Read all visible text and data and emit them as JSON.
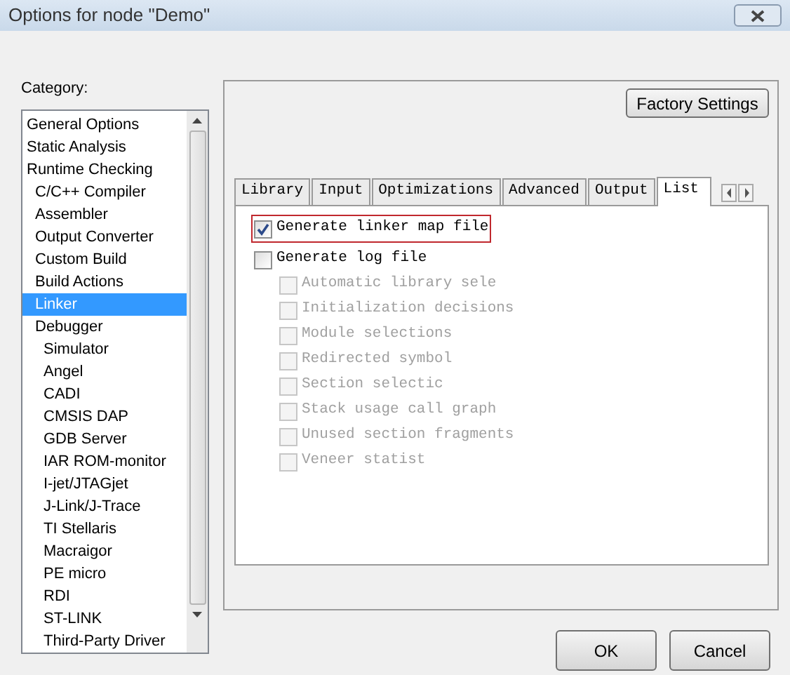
{
  "window": {
    "title": "Options for node \"Demo\""
  },
  "category": {
    "label": "Category:",
    "items": [
      {
        "label": "General Options",
        "selected": false
      },
      {
        "label": "Static Analysis",
        "selected": false
      },
      {
        "label": "Runtime Checking",
        "selected": false,
        "children": [
          {
            "label": "C/C++ Compiler",
            "selected": false
          },
          {
            "label": "Assembler",
            "selected": false
          },
          {
            "label": "Output Converter",
            "selected": false
          },
          {
            "label": "Custom Build",
            "selected": false
          },
          {
            "label": "Build Actions",
            "selected": false
          },
          {
            "label": "Linker",
            "selected": true
          },
          {
            "label": "Debugger",
            "selected": false,
            "children": [
              {
                "label": "Simulator",
                "selected": false
              },
              {
                "label": "Angel",
                "selected": false
              },
              {
                "label": "CADI",
                "selected": false
              },
              {
                "label": "CMSIS DAP",
                "selected": false
              },
              {
                "label": "GDB Server",
                "selected": false
              },
              {
                "label": "IAR ROM-monitor",
                "selected": false
              },
              {
                "label": "I-jet/JTAGjet",
                "selected": false
              },
              {
                "label": "J-Link/J-Trace",
                "selected": false
              },
              {
                "label": "TI Stellaris",
                "selected": false
              },
              {
                "label": "Macraigor",
                "selected": false
              },
              {
                "label": "PE micro",
                "selected": false
              },
              {
                "label": "RDI",
                "selected": false
              },
              {
                "label": "ST-LINK",
                "selected": false
              },
              {
                "label": "Third-Party Driver",
                "selected": false
              }
            ]
          }
        ]
      }
    ]
  },
  "factory_button": "Factory Settings",
  "tabs": [
    {
      "label": "Library",
      "selected": false
    },
    {
      "label": "Input",
      "selected": false
    },
    {
      "label": "Optimizations",
      "selected": false
    },
    {
      "label": "Advanced",
      "selected": false
    },
    {
      "label": "Output",
      "selected": false
    },
    {
      "label": "List",
      "selected": true
    }
  ],
  "options": [
    {
      "label": "Generate linker map file",
      "checked": true,
      "disabled": false,
      "highlighted": true
    },
    {
      "label": "Generate log file",
      "checked": false,
      "disabled": false,
      "highlighted": false,
      "children": [
        {
          "label": "Automatic library sele",
          "checked": false,
          "disabled": true,
          "highlighted": false
        },
        {
          "label": "Initialization decisions",
          "checked": false,
          "disabled": true,
          "highlighted": false
        },
        {
          "label": "Module selections",
          "checked": false,
          "disabled": true,
          "highlighted": false
        },
        {
          "label": "Redirected symbol",
          "checked": false,
          "disabled": true,
          "highlighted": false
        },
        {
          "label": "Section selectic",
          "checked": false,
          "disabled": true,
          "highlighted": false
        },
        {
          "label": "Stack usage call graph",
          "checked": false,
          "disabled": true,
          "highlighted": false
        },
        {
          "label": "Unused section fragments",
          "checked": false,
          "disabled": true,
          "highlighted": false
        },
        {
          "label": "Veneer statist",
          "checked": false,
          "disabled": true,
          "highlighted": false
        }
      ]
    }
  ],
  "buttons": [
    "OK",
    "Cancel"
  ]
}
